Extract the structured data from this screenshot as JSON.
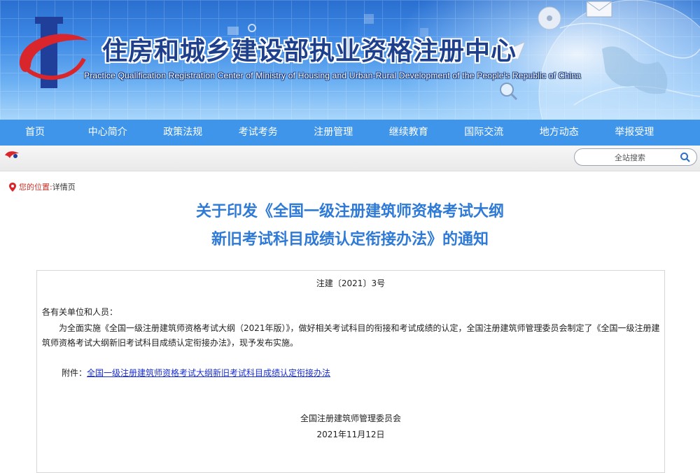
{
  "header": {
    "title": "住房和城乡建设部执业资格注册中心",
    "subtitle": "Practice Qualification Registration Center of Ministry of Housing and Urban-Rural Development of the People's Republic of China"
  },
  "nav": {
    "items": [
      "首页",
      "中心简介",
      "政策法规",
      "考试考务",
      "注册管理",
      "继续教育",
      "国际交流",
      "地方动态",
      "举报受理"
    ]
  },
  "search": {
    "placeholder": "全站搜索"
  },
  "breadcrumb": {
    "label": "您的位置:",
    "current": "详情页"
  },
  "article": {
    "title_line1": "关于印发《全国一级注册建筑师资格考试大纲",
    "title_line2": "新旧考试科目成绩认定衔接办法》的通知",
    "doc_number": "注建〔2021〕3号",
    "salutation": "各有关单位和人员：",
    "body": "为全面实施《全国一级注册建筑师资格考试大纲（2021年版）》，做好相关考试科目的衔接和考试成绩的认定，全国注册建筑师管理委员会制定了《全国一级注册建筑师资格考试大纲新旧考试科目成绩认定衔接办法》，现予发布实施。",
    "attachment_label": "附件：",
    "attachment_link": "全国一级注册建筑师资格考试大纲新旧考试科目成绩认定衔接办法",
    "signer": "全国注册建筑师管理委员会",
    "date": "2021年11月12日"
  },
  "colors": {
    "nav_bg": "#3f95ea",
    "title_blue": "#2e7ad6",
    "link_blue": "#1a2fd6",
    "logo_red": "#d8262c",
    "logo_blue": "#1f3f9a"
  }
}
